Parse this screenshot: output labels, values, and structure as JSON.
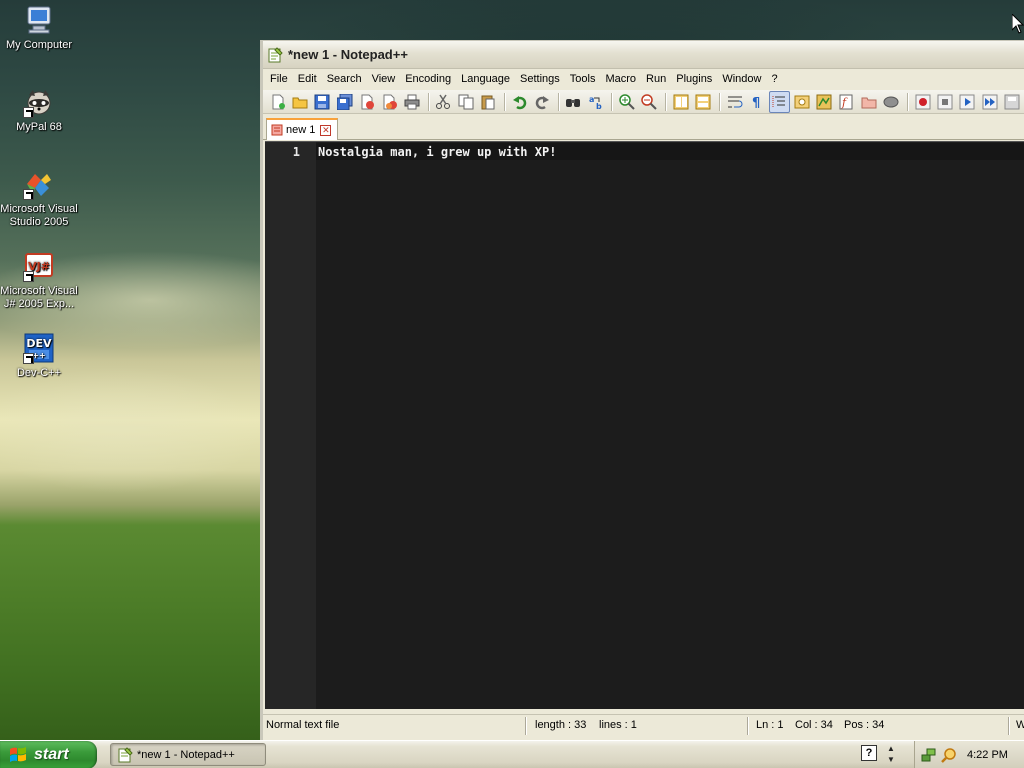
{
  "desktop": {
    "icons": [
      {
        "label": "My Computer"
      },
      {
        "label": "MyPal 68"
      },
      {
        "label": "Microsoft Visual Studio 2005"
      },
      {
        "label": "Microsoft Visual J# 2005 Exp..."
      },
      {
        "label": "Dev-C++"
      }
    ]
  },
  "window": {
    "title": "*new 1 - Notepad++",
    "menu": [
      "File",
      "Edit",
      "Search",
      "View",
      "Encoding",
      "Language",
      "Settings",
      "Tools",
      "Macro",
      "Run",
      "Plugins",
      "Window",
      "?"
    ],
    "toolbar_icons": [
      "new-file-icon",
      "open-file-icon",
      "save-icon",
      "save-all-icon",
      "close-icon",
      "close-all-icon",
      "print-icon",
      "cut-icon",
      "copy-icon",
      "paste-icon",
      "undo-icon",
      "redo-icon",
      "find-icon",
      "replace-icon",
      "zoom-in-icon",
      "zoom-out-icon",
      "sync-vertical-icon",
      "sync-horizontal-icon",
      "word-wrap-icon",
      "show-all-chars-icon",
      "indent-guide-icon",
      "user-language-icon",
      "document-map-icon",
      "function-list-icon",
      "folder-workspace-icon",
      "monitoring-icon",
      "record-macro-icon",
      "stop-macro-icon",
      "play-macro-icon",
      "run-macro-multiple-icon",
      "save-macro-icon"
    ],
    "tab": {
      "label": "new 1"
    },
    "editor": {
      "line_number": "1",
      "text": "Nostalgia man, i grew up with XP!"
    },
    "status": {
      "file_type": "Normal text file",
      "length": "length : 33",
      "lines": "lines : 1",
      "ln": "Ln : 1",
      "col": "Col : 34",
      "pos": "Pos : 34",
      "eol_partial": "W"
    }
  },
  "taskbar": {
    "start_label": "start",
    "task_label": "*new 1 - Notepad++",
    "help_label": "?",
    "clock": "4:22 PM"
  },
  "colors": {
    "editor_bg": "#1c1c1c",
    "editor_text": "#f2f2f2",
    "tab_accent": "#f9a23a",
    "start_green": "#3a9a3a"
  }
}
